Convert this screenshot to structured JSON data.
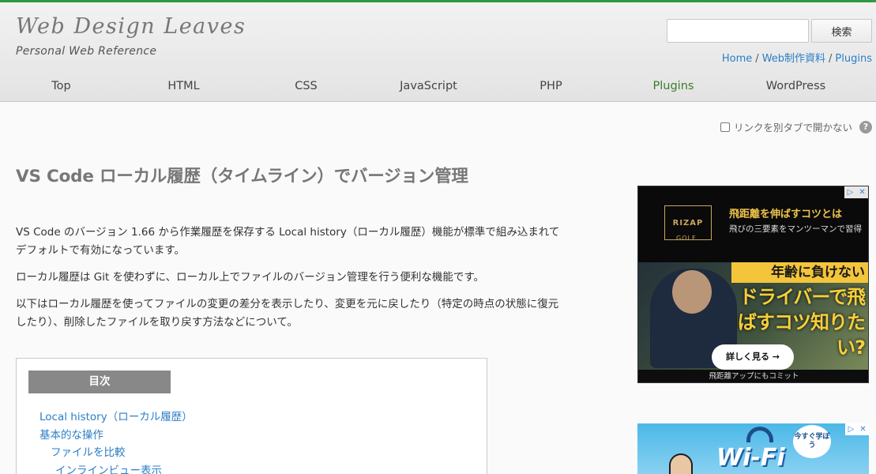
{
  "site": {
    "title": "Web Design Leaves",
    "subtitle": "Personal Web Reference"
  },
  "search": {
    "value": "",
    "button_label": "検索"
  },
  "breadcrumb": {
    "items": [
      "Home",
      "Web制作資料",
      "Plugins"
    ],
    "separator": "/"
  },
  "nav": {
    "items": [
      "Top",
      "HTML",
      "CSS",
      "JavaScript",
      "PHP",
      "Plugins",
      "WordPress"
    ],
    "active": "Plugins"
  },
  "newtab_toggle": {
    "label": "リンクを別タブで開かない",
    "checked": false,
    "help_icon": "?"
  },
  "article": {
    "title": "VS Code ローカル履歴（タイムライン）でバージョン管理",
    "paragraphs": [
      "VS Code のバージョン 1.66 から作業履歴を保存する Local history（ローカル履歴）機能が標準で組み込まれてデフォルトで有効になっています。",
      "ローカル履歴は Git を使わずに、ローカル上でファイルのバージョン管理を行う便利な機能です。",
      "以下はローカル履歴を使ってファイルの変更の差分を表示したり、変更を元に戻したり（特定の時点の状態に復元したり）、削除したファイルを取り戻す方法などについて。"
    ]
  },
  "toc": {
    "header": "目次",
    "items": [
      {
        "label": "Local history（ローカル履歴）",
        "level": 1
      },
      {
        "label": "基本的な操作",
        "level": 1
      },
      {
        "label": "ファイルを比較",
        "level": 2
      },
      {
        "label": "インラインビュー表示",
        "level": 3
      }
    ]
  },
  "ads": {
    "ad1": {
      "brand": "RIZAP",
      "brand_sub": "GOLF",
      "headline": "飛距離を伸ばすコツとは",
      "subline": "飛びの三要素をマンツーマンで習得",
      "big_line1": "年齢に負けない",
      "big_line2": "ドライバーで飛ばすコツ知りたい?",
      "cta": "詳しく見る →",
      "footer": "飛距離アップにもコミット"
    },
    "ad2": {
      "headline": "Wi-Fi",
      "bubble": "今すぐ学ぼう"
    },
    "adchoice_icons": [
      "▷",
      "✕"
    ]
  },
  "colors": {
    "accent_green": "#2e9a3e",
    "link_blue": "#2a7ec6",
    "nav_active": "#3a7d2c"
  }
}
